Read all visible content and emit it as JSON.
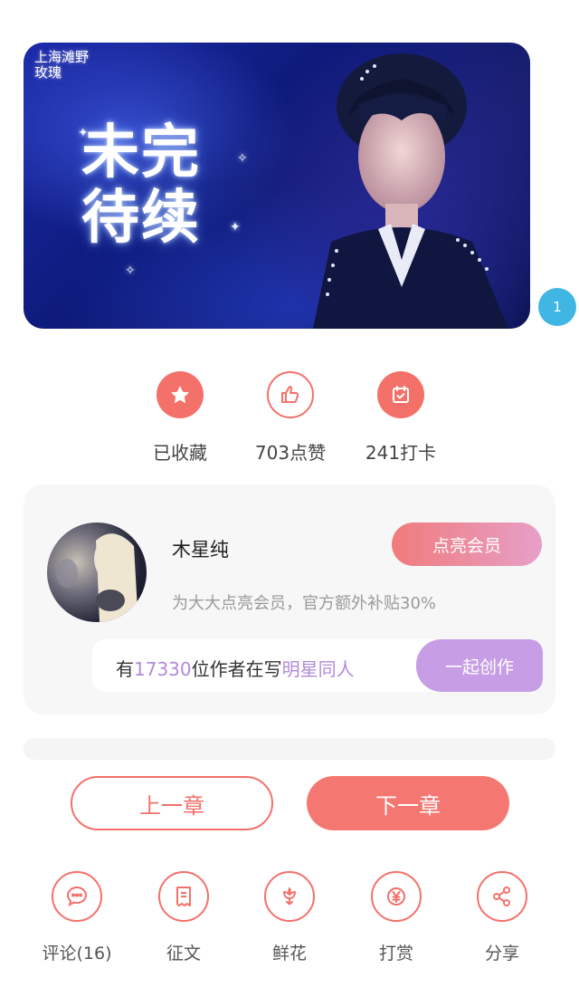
{
  "banner": {
    "logo_text": "上海滩野玫瑰",
    "title": "未完待续"
  },
  "page_badge": "1",
  "stats": [
    {
      "label": "已收藏",
      "icon": "star-icon"
    },
    {
      "label": "703点赞",
      "icon": "thumbs-up-icon"
    },
    {
      "label": "241打卡",
      "icon": "calendar-check-icon"
    }
  ],
  "author": {
    "name": "木星纯",
    "member_button": "点亮会员",
    "member_desc": "为大大点亮会员，官方额外补贴30%",
    "write_prefix": "有",
    "writer_count": "17330",
    "write_middle": "位作者在写",
    "topic": "明星同人",
    "create_button": "一起创作"
  },
  "nav": {
    "prev": "上一章",
    "next": "下一章"
  },
  "actions": [
    {
      "label": "评论(16)",
      "icon": "comment-icon"
    },
    {
      "label": "征文",
      "icon": "document-icon"
    },
    {
      "label": "鲜花",
      "icon": "flower-icon"
    },
    {
      "label": "打赏",
      "icon": "yen-coin-icon"
    },
    {
      "label": "分享",
      "icon": "share-icon"
    }
  ],
  "colors": {
    "accent": "#f4716a",
    "purple": "#c79ee6",
    "badge": "#3fb6e3"
  }
}
